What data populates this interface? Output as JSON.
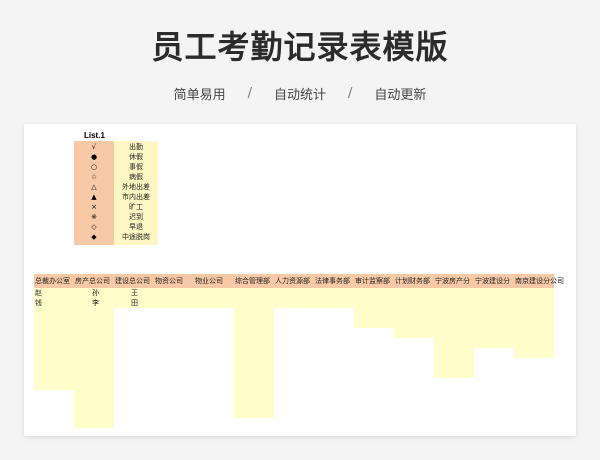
{
  "page": {
    "title": "员工考勤记录表模版",
    "features": [
      "简单易用",
      "自动统计",
      "自动更新"
    ],
    "separator": "/"
  },
  "sheet": {
    "list_title": "List.1",
    "legend": [
      {
        "symbol": "√",
        "label": "出勤"
      },
      {
        "symbol": "●",
        "label": "休假"
      },
      {
        "symbol": "○",
        "label": "事假"
      },
      {
        "symbol": "☆",
        "label": "病假"
      },
      {
        "symbol": "△",
        "label": "外地出差"
      },
      {
        "symbol": "▲",
        "label": "市内出差"
      },
      {
        "symbol": "×",
        "label": "旷工"
      },
      {
        "symbol": "※",
        "label": "迟到"
      },
      {
        "symbol": "◇",
        "label": "早退"
      },
      {
        "symbol": "◆",
        "label": "中途脱岗"
      }
    ],
    "departments": [
      "总裁办公室",
      "房产总公司",
      "建设总公司",
      "物资公司",
      "物业公司",
      "综合管理部",
      "人力资源部",
      "法律事务部",
      "审计监察部",
      "计划财务部",
      "宁波房产分",
      "宁波建设分",
      "南京建设分公司"
    ],
    "names": [
      [
        "赵",
        "孙",
        "王"
      ],
      [
        "钱",
        "李",
        "田"
      ]
    ]
  },
  "colors": {
    "header_orange": "#f8c9a6",
    "cell_yellow": "#fffdc9"
  }
}
